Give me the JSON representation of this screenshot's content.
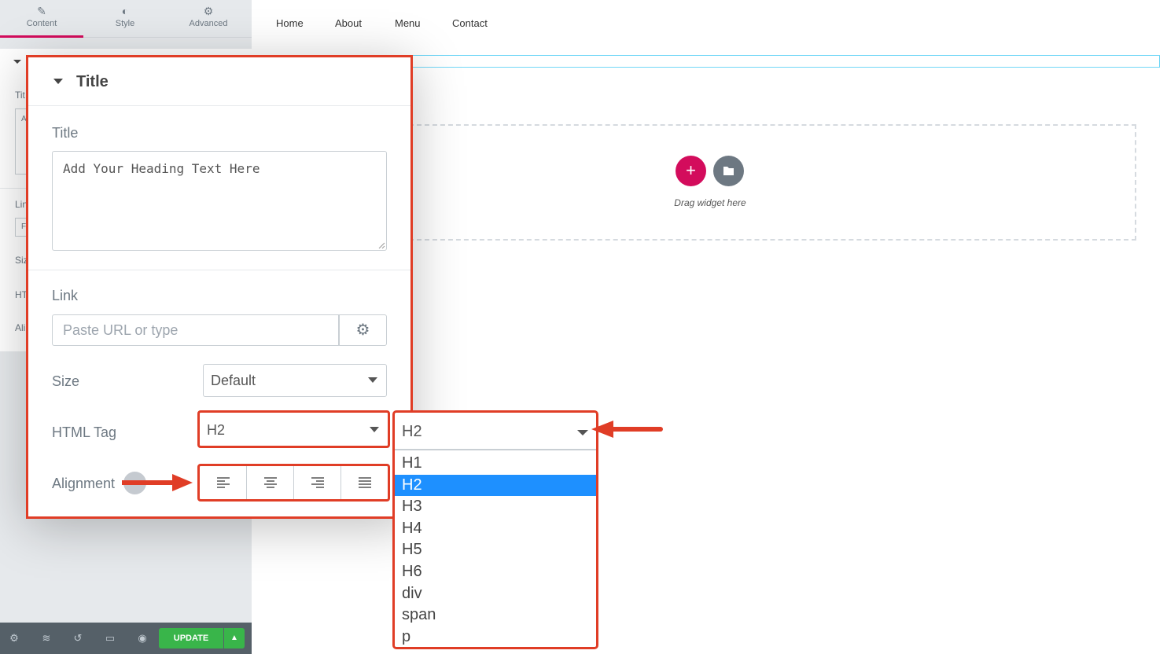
{
  "editor_tabs": [
    {
      "label": "Content",
      "icon": "pencil-icon"
    },
    {
      "label": "Style",
      "icon": "half-circle-icon"
    },
    {
      "label": "Advanced",
      "icon": "gear-icon"
    }
  ],
  "bg_panel_fragments": [
    "Tit",
    "A",
    "Lin",
    "F",
    "Siz",
    "HT",
    "Ali"
  ],
  "bottom_bar": {
    "icons": [
      "settings-icon",
      "layers-icon",
      "history-icon",
      "responsive-icon",
      "preview-icon"
    ],
    "update_label": "UPDATE"
  },
  "site_nav": [
    "Home",
    "About",
    "Menu",
    "Contact"
  ],
  "canvas": {
    "drag_text": "Drag widget here",
    "add_symbol": "+"
  },
  "title_panel": {
    "header": "Title",
    "title_label": "Title",
    "title_value": "Add Your Heading Text Here",
    "link_label": "Link",
    "link_placeholder": "Paste URL or type",
    "size_label": "Size",
    "size_value": "Default",
    "html_tag_label": "HTML Tag",
    "html_tag_value": "H2",
    "alignment_label": "Alignment",
    "alignment_options": [
      "left",
      "center",
      "right",
      "justify"
    ]
  },
  "html_tag_dropdown": {
    "selected": "H2",
    "options": [
      "H1",
      "H2",
      "H3",
      "H4",
      "H5",
      "H6",
      "div",
      "span",
      "p"
    ]
  },
  "colors": {
    "accent": "#d30c5c",
    "highlight": "#e03d26",
    "selected_option": "#1e90ff",
    "update_button": "#39b54a"
  }
}
